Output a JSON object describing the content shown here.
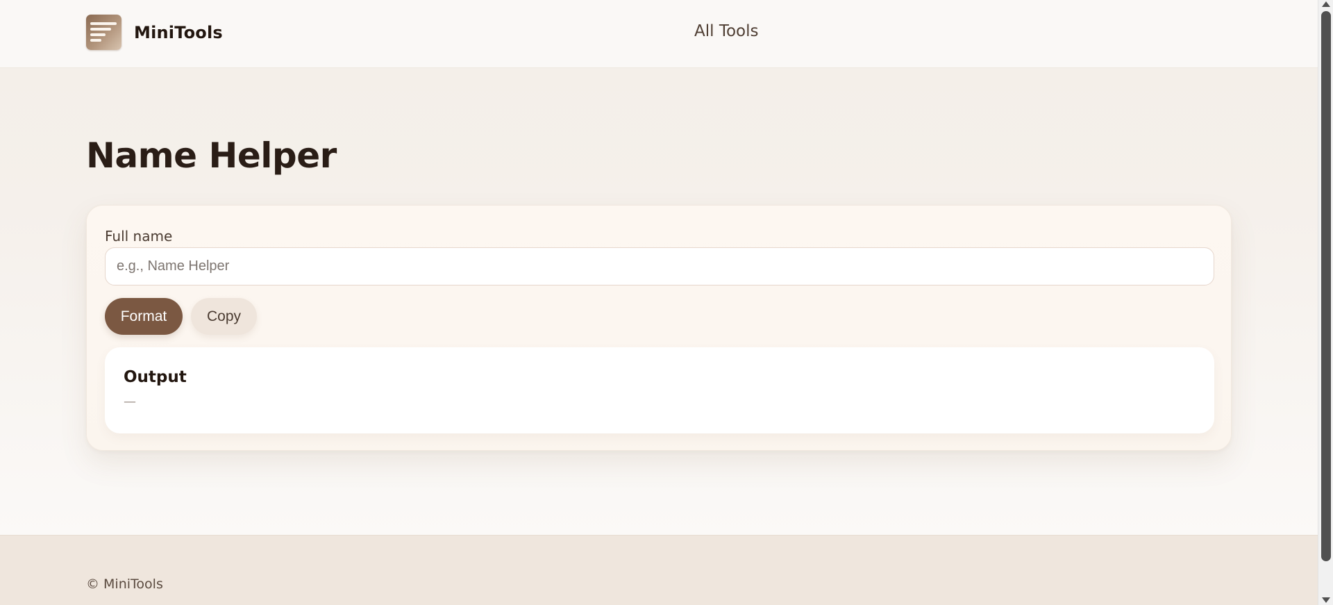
{
  "header": {
    "brand_name": "MiniTools",
    "logo_icon": "lines-icon",
    "nav_all_tools": "All Tools"
  },
  "main": {
    "title": "Name Helper",
    "field_label": "Full name",
    "input_value": "",
    "input_placeholder": "e.g., Name Helper",
    "format_label": "Format",
    "copy_label": "Copy",
    "output_title": "Output",
    "output_value": "—"
  },
  "footer": {
    "copyright": "© MiniTools"
  },
  "colors": {
    "accent": "#7b5842",
    "page_bg": "#f4efe9",
    "footer_bg": "#efe6dd",
    "secondary_button": "#efe5dc"
  }
}
